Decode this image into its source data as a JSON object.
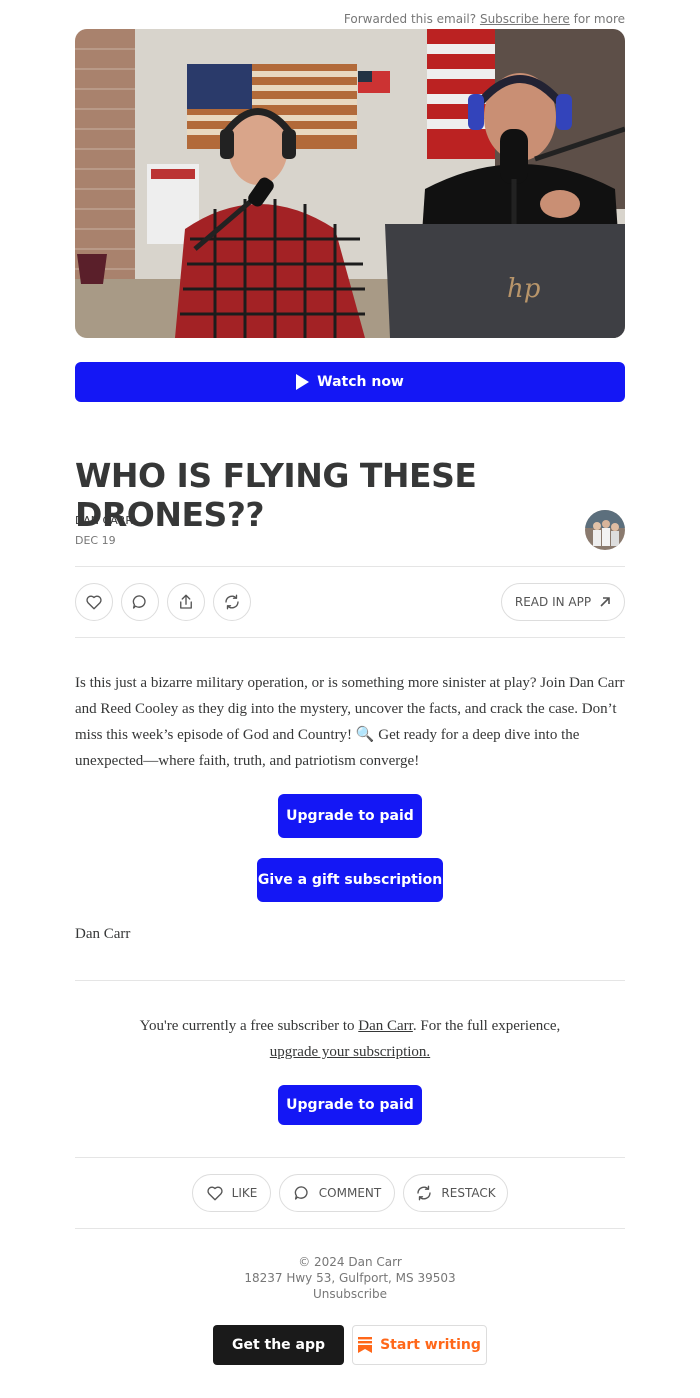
{
  "header": {
    "forwarded_text": "Forwarded this email?",
    "subscribe_link": "Subscribe here",
    "forwarded_suffix": "for more"
  },
  "video": {
    "watch_label": "Watch now",
    "laptop_logo": "hp"
  },
  "post": {
    "title": "WHO IS FLYING THESE DRONES??",
    "author": "DAN CARR",
    "date": "DEC 19",
    "read_in_app": "READ IN APP",
    "body": "Is this just a bizarre military operation, or is something more sinister at play? Join Dan Carr and Reed Cooley as they dig into the mystery, uncover the facts, and crack the case. Don’t miss this week’s episode of God and Country! 🔍 Get ready for a deep dive into the unexpected—where faith, truth, and patriotism converge!",
    "upgrade_label": "Upgrade to paid",
    "gift_label": "Give a gift subscription",
    "signoff": "Dan Carr"
  },
  "subscription_note": {
    "prefix": "You're currently a free subscriber to",
    "publication": "Dan Carr",
    "middle": ". For the full experience,",
    "link": "upgrade your subscription.",
    "upgrade_label": "Upgrade to paid"
  },
  "actions": {
    "like": "LIKE",
    "comment": "COMMENT",
    "restack": "RESTACK"
  },
  "footer": {
    "copyright": "© 2024 Dan Carr",
    "address": "18237 Hwy 53, Gulfport, MS 39503",
    "unsubscribe": "Unsubscribe",
    "get_app": "Get the app",
    "start_writing": "Start writing"
  },
  "colors": {
    "accent_blue": "#1417f5",
    "substack_orange": "#ff6719",
    "text": "#363737"
  },
  "icons": [
    "play-icon",
    "heart-icon",
    "comment-icon",
    "share-icon",
    "restack-icon",
    "arrow-up-right-icon",
    "substack-logo-icon"
  ]
}
